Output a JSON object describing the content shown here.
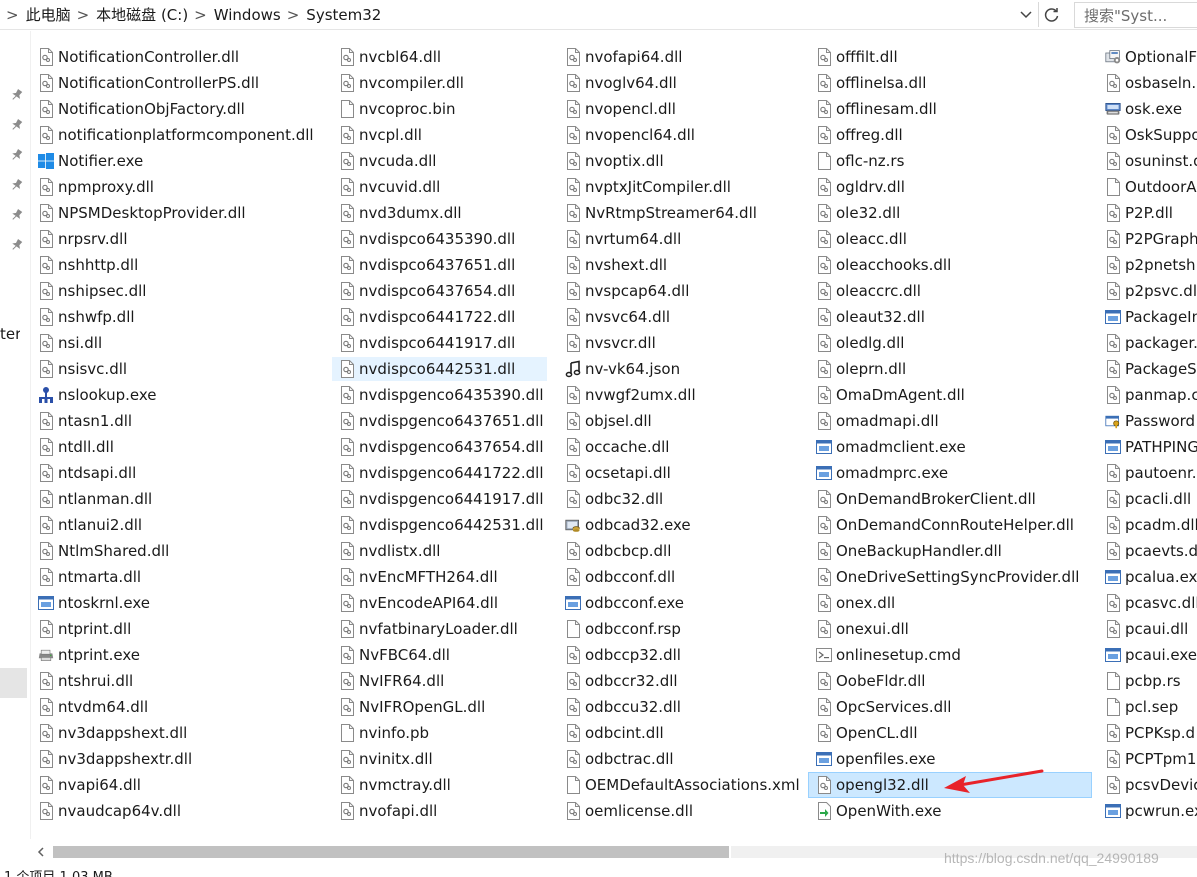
{
  "address_bar": {
    "crumbs": [
      "此电脑",
      "本地磁盘 (C:)",
      "Windows",
      "System32"
    ],
    "separator": ">"
  },
  "search": {
    "placeholder": "搜索\"Syst..."
  },
  "nav_pane": {
    "cut_text": "ter"
  },
  "columns": [
    [
      {
        "name": "NotificationController.dll",
        "icon": "dll-icon"
      },
      {
        "name": "NotificationControllerPS.dll",
        "icon": "dll-icon"
      },
      {
        "name": "NotificationObjFactory.dll",
        "icon": "dll-icon"
      },
      {
        "name": "notificationplatformcomponent.dll",
        "icon": "dll-icon"
      },
      {
        "name": "Notifier.exe",
        "icon": "windows-logo-icon"
      },
      {
        "name": "npmproxy.dll",
        "icon": "dll-icon"
      },
      {
        "name": "NPSMDesktopProvider.dll",
        "icon": "dll-icon"
      },
      {
        "name": "nrpsrv.dll",
        "icon": "dll-icon"
      },
      {
        "name": "nshhttp.dll",
        "icon": "dll-icon"
      },
      {
        "name": "nshipsec.dll",
        "icon": "dll-icon"
      },
      {
        "name": "nshwfp.dll",
        "icon": "dll-icon"
      },
      {
        "name": "nsi.dll",
        "icon": "dll-icon"
      },
      {
        "name": "nsisvc.dll",
        "icon": "dll-icon"
      },
      {
        "name": "nslookup.exe",
        "icon": "network-exe-icon"
      },
      {
        "name": "ntasn1.dll",
        "icon": "dll-icon"
      },
      {
        "name": "ntdll.dll",
        "icon": "dll-icon"
      },
      {
        "name": "ntdsapi.dll",
        "icon": "dll-icon"
      },
      {
        "name": "ntlanman.dll",
        "icon": "dll-icon"
      },
      {
        "name": "ntlanui2.dll",
        "icon": "dll-icon"
      },
      {
        "name": "NtlmShared.dll",
        "icon": "dll-icon"
      },
      {
        "name": "ntmarta.dll",
        "icon": "dll-icon"
      },
      {
        "name": "ntoskrnl.exe",
        "icon": "exe-icon"
      },
      {
        "name": "ntprint.dll",
        "icon": "dll-icon"
      },
      {
        "name": "ntprint.exe",
        "icon": "printer-icon"
      },
      {
        "name": "ntshrui.dll",
        "icon": "dll-icon"
      },
      {
        "name": "ntvdm64.dll",
        "icon": "dll-icon"
      },
      {
        "name": "nv3dappshext.dll",
        "icon": "dll-icon"
      },
      {
        "name": "nv3dappshextr.dll",
        "icon": "dll-icon"
      },
      {
        "name": "nvapi64.dll",
        "icon": "dll-icon"
      },
      {
        "name": "nvaudcap64v.dll",
        "icon": "dll-icon"
      }
    ],
    [
      {
        "name": "nvcbl64.dll",
        "icon": "dll-icon"
      },
      {
        "name": "nvcompiler.dll",
        "icon": "dll-icon"
      },
      {
        "name": "nvcoproc.bin",
        "icon": "blank-file-icon"
      },
      {
        "name": "nvcpl.dll",
        "icon": "dll-icon"
      },
      {
        "name": "nvcuda.dll",
        "icon": "dll-icon"
      },
      {
        "name": "nvcuvid.dll",
        "icon": "dll-icon"
      },
      {
        "name": "nvd3dumx.dll",
        "icon": "dll-icon"
      },
      {
        "name": "nvdispco6435390.dll",
        "icon": "dll-icon"
      },
      {
        "name": "nvdispco6437651.dll",
        "icon": "dll-icon"
      },
      {
        "name": "nvdispco6437654.dll",
        "icon": "dll-icon"
      },
      {
        "name": "nvdispco6441722.dll",
        "icon": "dll-icon"
      },
      {
        "name": "nvdispco6441917.dll",
        "icon": "dll-icon"
      },
      {
        "name": "nvdispco6442531.dll",
        "icon": "dll-icon",
        "state": "hover"
      },
      {
        "name": "nvdispgenco6435390.dll",
        "icon": "dll-icon"
      },
      {
        "name": "nvdispgenco6437651.dll",
        "icon": "dll-icon"
      },
      {
        "name": "nvdispgenco6437654.dll",
        "icon": "dll-icon"
      },
      {
        "name": "nvdispgenco6441722.dll",
        "icon": "dll-icon"
      },
      {
        "name": "nvdispgenco6441917.dll",
        "icon": "dll-icon"
      },
      {
        "name": "nvdispgenco6442531.dll",
        "icon": "dll-icon"
      },
      {
        "name": "nvdlistx.dll",
        "icon": "dll-icon"
      },
      {
        "name": "nvEncMFTH264.dll",
        "icon": "dll-icon"
      },
      {
        "name": "nvEncodeAPI64.dll",
        "icon": "dll-icon"
      },
      {
        "name": "nvfatbinaryLoader.dll",
        "icon": "dll-icon"
      },
      {
        "name": "NvFBC64.dll",
        "icon": "dll-icon"
      },
      {
        "name": "NvIFR64.dll",
        "icon": "dll-icon"
      },
      {
        "name": "NvIFROpenGL.dll",
        "icon": "dll-icon"
      },
      {
        "name": "nvinfo.pb",
        "icon": "blank-file-icon"
      },
      {
        "name": "nvinitx.dll",
        "icon": "dll-icon"
      },
      {
        "name": "nvmctray.dll",
        "icon": "dll-icon"
      },
      {
        "name": "nvofapi.dll",
        "icon": "dll-icon"
      }
    ],
    [
      {
        "name": "nvofapi64.dll",
        "icon": "dll-icon"
      },
      {
        "name": "nvoglv64.dll",
        "icon": "dll-icon"
      },
      {
        "name": "nvopencl.dll",
        "icon": "dll-icon"
      },
      {
        "name": "nvopencl64.dll",
        "icon": "dll-icon"
      },
      {
        "name": "nvoptix.dll",
        "icon": "dll-icon"
      },
      {
        "name": "nvptxJitCompiler.dll",
        "icon": "dll-icon"
      },
      {
        "name": "NvRtmpStreamer64.dll",
        "icon": "dll-icon"
      },
      {
        "name": "nvrtum64.dll",
        "icon": "dll-icon"
      },
      {
        "name": "nvshext.dll",
        "icon": "dll-icon"
      },
      {
        "name": "nvspcap64.dll",
        "icon": "dll-icon"
      },
      {
        "name": "nvsvc64.dll",
        "icon": "dll-icon"
      },
      {
        "name": "nvsvcr.dll",
        "icon": "dll-icon"
      },
      {
        "name": "nv-vk64.json",
        "icon": "music-note-icon"
      },
      {
        "name": "nvwgf2umx.dll",
        "icon": "dll-icon"
      },
      {
        "name": "objsel.dll",
        "icon": "dll-icon"
      },
      {
        "name": "occache.dll",
        "icon": "dll-icon"
      },
      {
        "name": "ocsetapi.dll",
        "icon": "dll-icon"
      },
      {
        "name": "odbc32.dll",
        "icon": "dll-icon"
      },
      {
        "name": "odbcad32.exe",
        "icon": "database-exe-icon"
      },
      {
        "name": "odbcbcp.dll",
        "icon": "dll-icon"
      },
      {
        "name": "odbcconf.dll",
        "icon": "dll-icon"
      },
      {
        "name": "odbcconf.exe",
        "icon": "exe-icon"
      },
      {
        "name": "odbcconf.rsp",
        "icon": "blank-file-icon"
      },
      {
        "name": "odbccp32.dll",
        "icon": "dll-icon"
      },
      {
        "name": "odbccr32.dll",
        "icon": "dll-icon"
      },
      {
        "name": "odbccu32.dll",
        "icon": "dll-icon"
      },
      {
        "name": "odbcint.dll",
        "icon": "dll-icon"
      },
      {
        "name": "odbctrac.dll",
        "icon": "dll-icon"
      },
      {
        "name": "OEMDefaultAssociations.xml",
        "icon": "blank-file-icon"
      },
      {
        "name": "oemlicense.dll",
        "icon": "dll-icon"
      }
    ],
    [
      {
        "name": "offfilt.dll",
        "icon": "dll-icon"
      },
      {
        "name": "offlinelsa.dll",
        "icon": "dll-icon"
      },
      {
        "name": "offlinesam.dll",
        "icon": "dll-icon"
      },
      {
        "name": "offreg.dll",
        "icon": "dll-icon"
      },
      {
        "name": "oflc-nz.rs",
        "icon": "blank-file-icon"
      },
      {
        "name": "ogldrv.dll",
        "icon": "dll-icon"
      },
      {
        "name": "ole32.dll",
        "icon": "dll-icon"
      },
      {
        "name": "oleacc.dll",
        "icon": "dll-icon"
      },
      {
        "name": "oleacchooks.dll",
        "icon": "dll-icon"
      },
      {
        "name": "oleaccrc.dll",
        "icon": "dll-icon"
      },
      {
        "name": "oleaut32.dll",
        "icon": "dll-icon"
      },
      {
        "name": "oledlg.dll",
        "icon": "dll-icon"
      },
      {
        "name": "oleprn.dll",
        "icon": "dll-icon"
      },
      {
        "name": "OmaDmAgent.dll",
        "icon": "dll-icon"
      },
      {
        "name": "omadmapi.dll",
        "icon": "dll-icon"
      },
      {
        "name": "omadmclient.exe",
        "icon": "exe-icon"
      },
      {
        "name": "omadmprc.exe",
        "icon": "exe-icon"
      },
      {
        "name": "OnDemandBrokerClient.dll",
        "icon": "dll-icon"
      },
      {
        "name": "OnDemandConnRouteHelper.dll",
        "icon": "dll-icon"
      },
      {
        "name": "OneBackupHandler.dll",
        "icon": "dll-icon"
      },
      {
        "name": "OneDriveSettingSyncProvider.dll",
        "icon": "dll-icon"
      },
      {
        "name": "onex.dll",
        "icon": "dll-icon"
      },
      {
        "name": "onexui.dll",
        "icon": "dll-icon"
      },
      {
        "name": "onlinesetup.cmd",
        "icon": "cmd-file-icon"
      },
      {
        "name": "OobeFldr.dll",
        "icon": "dll-icon"
      },
      {
        "name": "OpcServices.dll",
        "icon": "dll-icon"
      },
      {
        "name": "OpenCL.dll",
        "icon": "dll-icon"
      },
      {
        "name": "openfiles.exe",
        "icon": "exe-icon"
      },
      {
        "name": "opengl32.dll",
        "icon": "dll-icon",
        "state": "selected"
      },
      {
        "name": "OpenWith.exe",
        "icon": "openwith-arrow-icon"
      }
    ],
    [
      {
        "name": "OptionalF",
        "icon": "optional-features-icon"
      },
      {
        "name": "osbaseln.d",
        "icon": "dll-icon"
      },
      {
        "name": "osk.exe",
        "icon": "keyboard-icon"
      },
      {
        "name": "OskSuppo",
        "icon": "dll-icon"
      },
      {
        "name": "osuninst.d",
        "icon": "dll-icon"
      },
      {
        "name": "OutdoorA",
        "icon": "blank-file-icon"
      },
      {
        "name": "P2P.dll",
        "icon": "dll-icon"
      },
      {
        "name": "P2PGraph",
        "icon": "dll-icon"
      },
      {
        "name": "p2pnetsh",
        "icon": "dll-icon"
      },
      {
        "name": "p2psvc.dl",
        "icon": "dll-icon"
      },
      {
        "name": "PackageIn",
        "icon": "exe-icon"
      },
      {
        "name": "packager.",
        "icon": "dll-icon"
      },
      {
        "name": "PackageS",
        "icon": "dll-icon"
      },
      {
        "name": "panmap.c",
        "icon": "dll-icon"
      },
      {
        "name": "Password",
        "icon": "password-exe-icon"
      },
      {
        "name": "PATHPING",
        "icon": "exe-icon"
      },
      {
        "name": "pautoenr.",
        "icon": "dll-icon"
      },
      {
        "name": "pcacli.dll",
        "icon": "dll-icon"
      },
      {
        "name": "pcadm.dll",
        "icon": "dll-icon"
      },
      {
        "name": "pcaevts.dl",
        "icon": "dll-icon"
      },
      {
        "name": "pcalua.exe",
        "icon": "exe-icon"
      },
      {
        "name": "pcasvc.dll",
        "icon": "dll-icon"
      },
      {
        "name": "pcaui.dll",
        "icon": "dll-icon"
      },
      {
        "name": "pcaui.exe",
        "icon": "exe-icon"
      },
      {
        "name": "pcbp.rs",
        "icon": "blank-file-icon"
      },
      {
        "name": "pcl.sep",
        "icon": "blank-file-icon"
      },
      {
        "name": "PCPKsp.d",
        "icon": "dll-icon"
      },
      {
        "name": "PCPTpm1",
        "icon": "dll-icon"
      },
      {
        "name": "pcsvDevic",
        "icon": "dll-icon"
      },
      {
        "name": "pcwrun.ex",
        "icon": "exe-icon"
      }
    ]
  ],
  "status": {
    "text": "1 个项目  1.03 MB"
  },
  "watermark": {
    "text": "https://blog.csdn.net/qq_24990189"
  },
  "colors": {
    "selection_fill": "#cce8ff",
    "selection_border": "#99d1ff",
    "hover_fill": "#e5f3ff",
    "annotation_arrow": "#e8232a"
  }
}
